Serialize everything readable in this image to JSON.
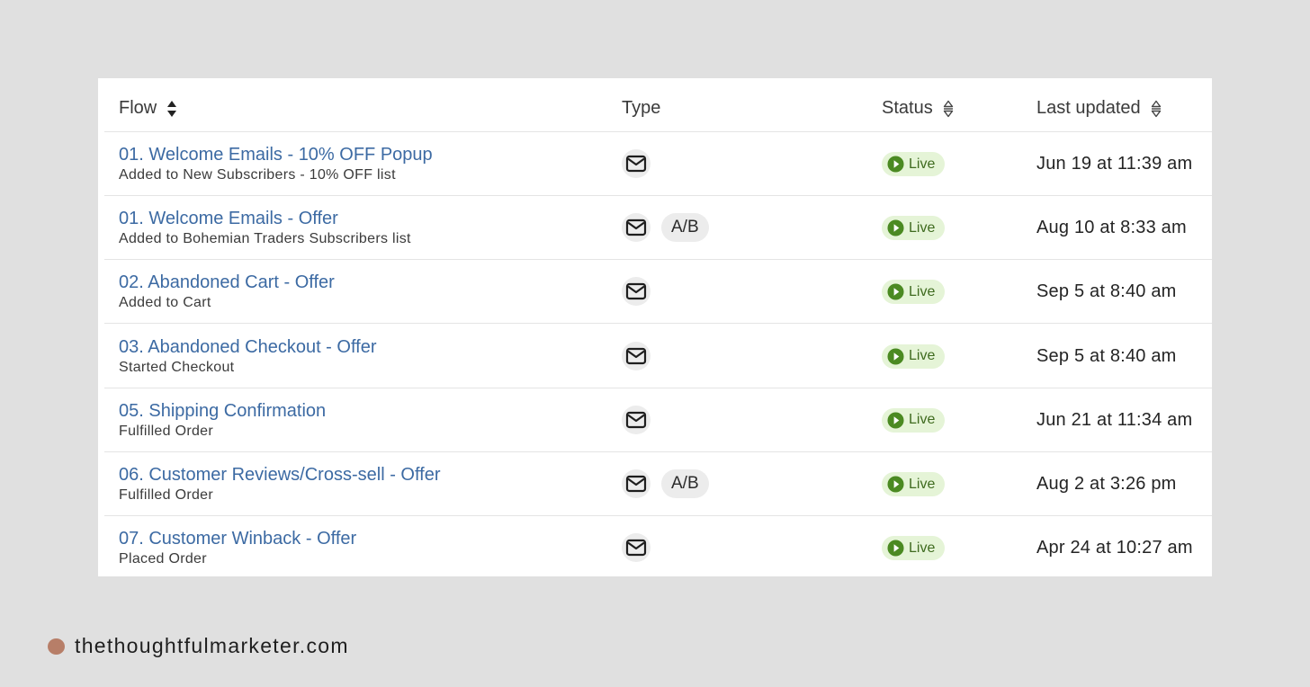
{
  "table": {
    "headers": {
      "flow": "Flow",
      "type": "Type",
      "status": "Status",
      "last_updated": "Last updated"
    },
    "rows": [
      {
        "name": "01. Welcome Emails - 10% OFF Popup",
        "trigger": "Added to New Subscribers - 10% OFF list",
        "type_icon": "mail-icon",
        "ab": "",
        "status": "Live",
        "updated": "Jun 19 at 11:39 am"
      },
      {
        "name": "01. Welcome Emails - Offer",
        "trigger": "Added to Bohemian Traders Subscribers list",
        "type_icon": "mail-icon",
        "ab": "A/B",
        "status": "Live",
        "updated": "Aug 10 at 8:33 am"
      },
      {
        "name": "02. Abandoned Cart - Offer",
        "trigger": "Added to Cart",
        "type_icon": "mail-icon",
        "ab": "",
        "status": "Live",
        "updated": "Sep 5 at 8:40 am"
      },
      {
        "name": "03. Abandoned Checkout - Offer",
        "trigger": "Started Checkout",
        "type_icon": "mail-icon",
        "ab": "",
        "status": "Live",
        "updated": "Sep 5 at 8:40 am"
      },
      {
        "name": "05. Shipping Confirmation",
        "trigger": "Fulfilled Order",
        "type_icon": "mail-icon",
        "ab": "",
        "status": "Live",
        "updated": "Jun 21 at 11:34 am"
      },
      {
        "name": "06. Customer Reviews/Cross-sell - Offer",
        "trigger": "Fulfilled Order",
        "type_icon": "mail-icon",
        "ab": "A/B",
        "status": "Live",
        "updated": "Aug 2 at 3:26 pm"
      },
      {
        "name": "07. Customer Winback - Offer",
        "trigger": "Placed Order",
        "type_icon": "mail-icon",
        "ab": "",
        "status": "Live",
        "updated": "Apr 24 at 10:27 am"
      }
    ]
  },
  "footer": {
    "text": "thethoughtfulmarketer.com"
  },
  "colors": {
    "link": "#3c6aa3",
    "live_bg": "#e5f4d7",
    "live_fg": "#3f6b1f",
    "live_icon": "#4b8a22",
    "footer_dot": "#b77e68"
  }
}
